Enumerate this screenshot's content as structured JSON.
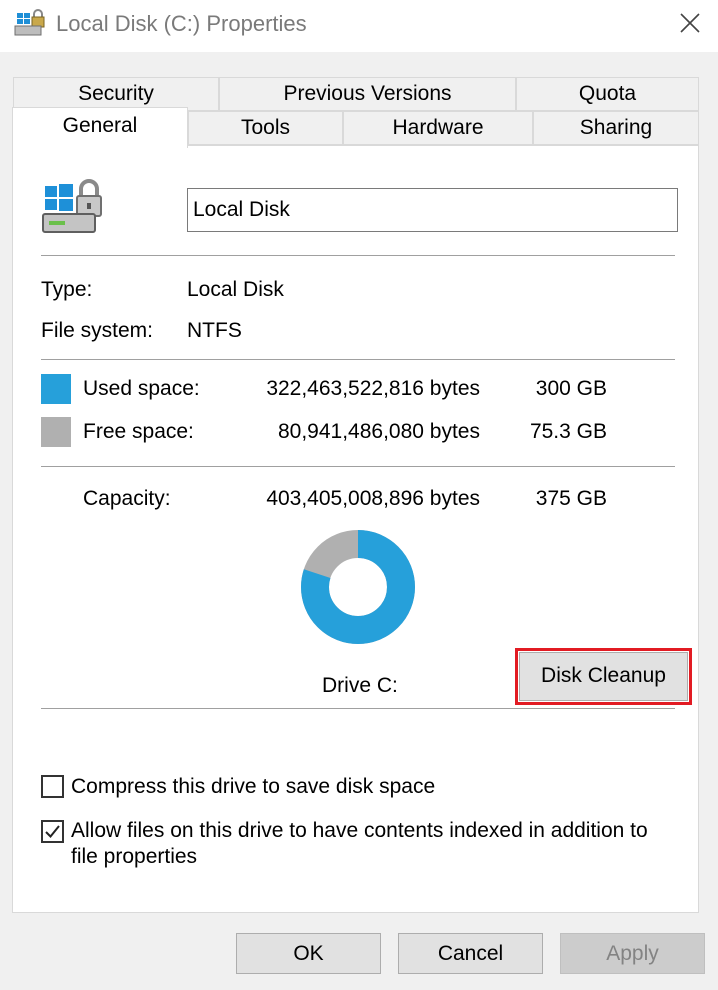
{
  "window": {
    "title": "Local Disk (C:) Properties",
    "icon": "drive-lock-icon",
    "close_icon": "close-icon"
  },
  "tabs": {
    "row1": [
      {
        "label": "Security"
      },
      {
        "label": "Previous Versions"
      },
      {
        "label": "Quota"
      }
    ],
    "row2": [
      {
        "label": "General",
        "active": true
      },
      {
        "label": "Tools"
      },
      {
        "label": "Hardware"
      },
      {
        "label": "Sharing"
      }
    ]
  },
  "general": {
    "drive_icon": "windows-drive-lock-icon",
    "name_value": "Local Disk",
    "type_label": "Type:",
    "type_value": "Local Disk",
    "fs_label": "File system:",
    "fs_value": "NTFS",
    "used": {
      "label": "Used space:",
      "bytes": "322,463,522,816 bytes",
      "size": "300 GB",
      "color": "#26a0da"
    },
    "free": {
      "label": "Free space:",
      "bytes": "80,941,486,080 bytes",
      "size": "75.3 GB",
      "color": "#b0b0b0"
    },
    "capacity": {
      "label": "Capacity:",
      "bytes": "403,405,008,896 bytes",
      "size": "375 GB"
    },
    "used_fraction": 0.7994,
    "drive_label": "Drive C:",
    "cleanup_label": "Disk Cleanup",
    "compress_label": "Compress this drive to save disk space",
    "compress_checked": false,
    "index_label_line1": "Allow files on this drive to have contents indexed in addition to",
    "index_label_line2": "file properties",
    "index_checked": true
  },
  "buttons": {
    "ok": "OK",
    "cancel": "Cancel",
    "apply": "Apply"
  }
}
